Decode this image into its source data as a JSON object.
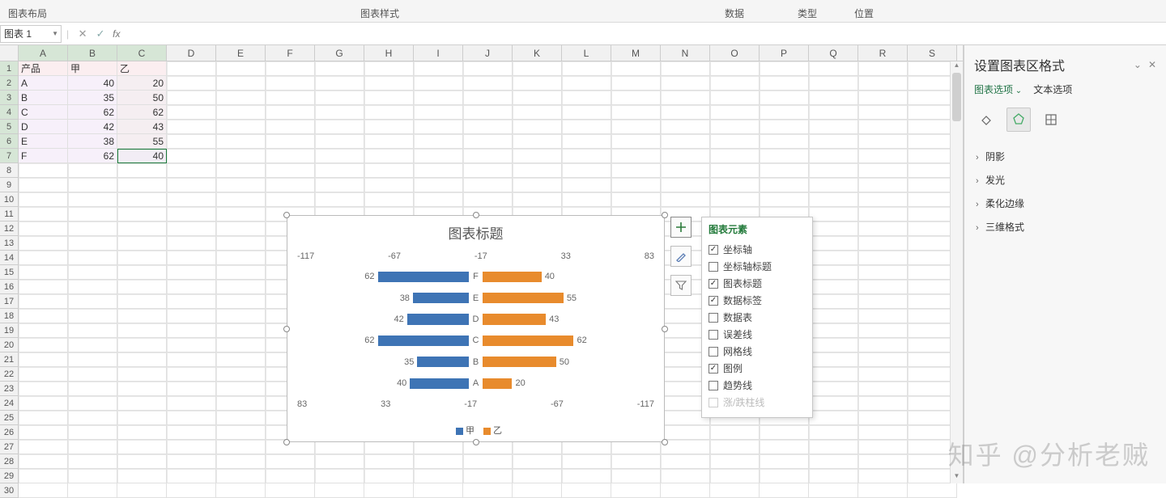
{
  "ribbon": {
    "layout_label": "图表布局",
    "style_label": "图表样式",
    "data_label": "数据",
    "type_label": "类型",
    "position_label": "位置"
  },
  "formula_bar": {
    "namebox_value": "图表 1",
    "fx_label": "fx"
  },
  "sheet": {
    "columns": [
      "A",
      "B",
      "C",
      "D",
      "E",
      "F",
      "G",
      "H",
      "I",
      "J",
      "K",
      "L",
      "M",
      "N",
      "O",
      "P",
      "Q",
      "R",
      "S"
    ],
    "row_numbers": [
      "1",
      "2",
      "3",
      "4",
      "5",
      "6",
      "7"
    ],
    "header_row": {
      "product": "产品",
      "jia": "甲",
      "yi": "乙"
    },
    "data_rows": [
      {
        "product": "A",
        "jia": "40",
        "yi": "20"
      },
      {
        "product": "B",
        "jia": "35",
        "yi": "50"
      },
      {
        "product": "C",
        "jia": "62",
        "yi": "62"
      },
      {
        "product": "D",
        "jia": "42",
        "yi": "43"
      },
      {
        "product": "E",
        "jia": "38",
        "yi": "55"
      },
      {
        "product": "F",
        "jia": "62",
        "yi": "40"
      }
    ]
  },
  "chart": {
    "title": "图表标题",
    "axis_top": [
      "-117",
      "-67",
      "-17",
      "33",
      "83"
    ],
    "axis_bottom": [
      "83",
      "33",
      "-17",
      "-67",
      "-117"
    ],
    "legend_jia": "甲",
    "legend_yi": "乙"
  },
  "chart_data": {
    "type": "bar",
    "title": "图表标题",
    "orientation": "horizontal-diverging",
    "categories": [
      "A",
      "B",
      "C",
      "D",
      "E",
      "F"
    ],
    "series": [
      {
        "name": "甲",
        "values": [
          40,
          35,
          62,
          42,
          38,
          62
        ],
        "color": "#3e74b5",
        "side": "left"
      },
      {
        "name": "乙",
        "values": [
          20,
          50,
          62,
          43,
          55,
          40
        ],
        "color": "#e88b2d",
        "side": "right"
      }
    ],
    "x_axis_top": {
      "ticks": [
        -117,
        -67,
        -17,
        33,
        83
      ]
    },
    "x_axis_bottom": {
      "ticks": [
        83,
        33,
        -17,
        -67,
        -117
      ]
    },
    "display_order": [
      "F",
      "E",
      "D",
      "C",
      "B",
      "A"
    ],
    "data_labels": true,
    "legend_position": "bottom"
  },
  "popup": {
    "title": "图表元素",
    "options": [
      {
        "label": "坐标轴",
        "checked": true
      },
      {
        "label": "坐标轴标题",
        "checked": false
      },
      {
        "label": "图表标题",
        "checked": true
      },
      {
        "label": "数据标签",
        "checked": true
      },
      {
        "label": "数据表",
        "checked": false
      },
      {
        "label": "误差线",
        "checked": false
      },
      {
        "label": "网格线",
        "checked": false
      },
      {
        "label": "图例",
        "checked": true
      },
      {
        "label": "趋势线",
        "checked": false
      },
      {
        "label": "涨/跌柱线",
        "checked": false,
        "disabled": true
      }
    ]
  },
  "format_pane": {
    "title": "设置图表区格式",
    "tab_options": "图表选项",
    "tab_text": "文本选项",
    "sections": [
      "阴影",
      "发光",
      "柔化边缘",
      "三维格式"
    ]
  },
  "watermark": "知乎 @分析老贼"
}
